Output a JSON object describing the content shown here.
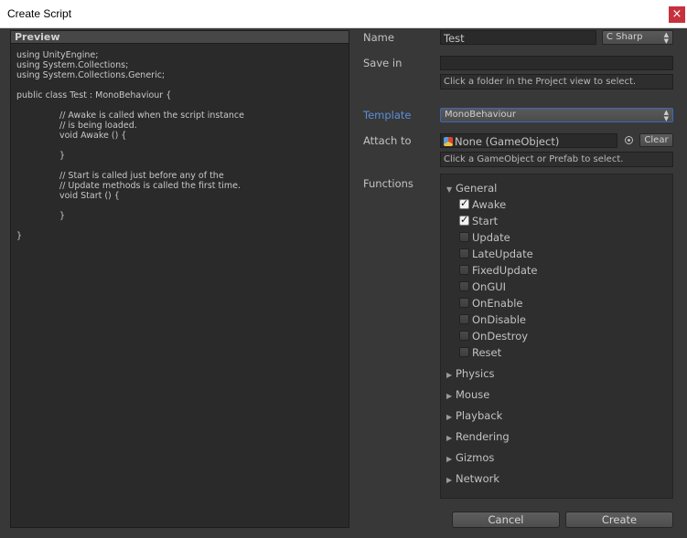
{
  "window": {
    "title": "Create Script",
    "close_glyph": "×"
  },
  "preview": {
    "header": "Preview",
    "code_lines": [
      {
        "text": "using UnityEngine;",
        "indent": false
      },
      {
        "text": "using System.Collections;",
        "indent": false
      },
      {
        "text": "using System.Collections.Generic;",
        "indent": false
      },
      {
        "text": "",
        "indent": false
      },
      {
        "text": "public class Test : MonoBehaviour {",
        "indent": false
      },
      {
        "text": "",
        "indent": false
      },
      {
        "text": "// Awake is called when the script instance",
        "indent": true
      },
      {
        "text": "// is being loaded.",
        "indent": true
      },
      {
        "text": "void Awake () {",
        "indent": true
      },
      {
        "text": "",
        "indent": false
      },
      {
        "text": "}",
        "indent": true
      },
      {
        "text": "",
        "indent": false
      },
      {
        "text": "// Start is called just before any of the",
        "indent": true
      },
      {
        "text": "// Update methods is called the first time.",
        "indent": true
      },
      {
        "text": "void Start () {",
        "indent": true
      },
      {
        "text": "",
        "indent": false
      },
      {
        "text": "}",
        "indent": true
      },
      {
        "text": "",
        "indent": false
      },
      {
        "text": "}",
        "indent": false
      }
    ]
  },
  "form": {
    "name_label": "Name",
    "name_value": "Test",
    "language": "C Sharp",
    "save_in_label": "Save in",
    "save_in_value": "",
    "save_in_hint": "Click a folder in the Project view to select.",
    "template_label": "Template",
    "template_value": "MonoBehaviour",
    "attach_label": "Attach to",
    "attach_value": "None (GameObject)",
    "clear_label": "Clear",
    "attach_hint": "Click a GameObject or Prefab to select.",
    "functions_label": "Functions"
  },
  "functions": {
    "general": {
      "label": "General",
      "expanded": true,
      "items": [
        {
          "name": "Awake",
          "checked": true
        },
        {
          "name": "Start",
          "checked": true
        },
        {
          "name": "Update",
          "checked": false
        },
        {
          "name": "LateUpdate",
          "checked": false
        },
        {
          "name": "FixedUpdate",
          "checked": false
        },
        {
          "name": "OnGUI",
          "checked": false
        },
        {
          "name": "OnEnable",
          "checked": false
        },
        {
          "name": "OnDisable",
          "checked": false
        },
        {
          "name": "OnDestroy",
          "checked": false
        },
        {
          "name": "Reset",
          "checked": false
        }
      ]
    },
    "collapsed_groups": [
      "Physics",
      "Mouse",
      "Playback",
      "Rendering",
      "Gizmos",
      "Network"
    ]
  },
  "buttons": {
    "cancel": "Cancel",
    "create": "Create"
  },
  "colors": {
    "accent_label": "#5b8ed8",
    "close_button": "#c7313d",
    "panel_bg": "#383838"
  }
}
